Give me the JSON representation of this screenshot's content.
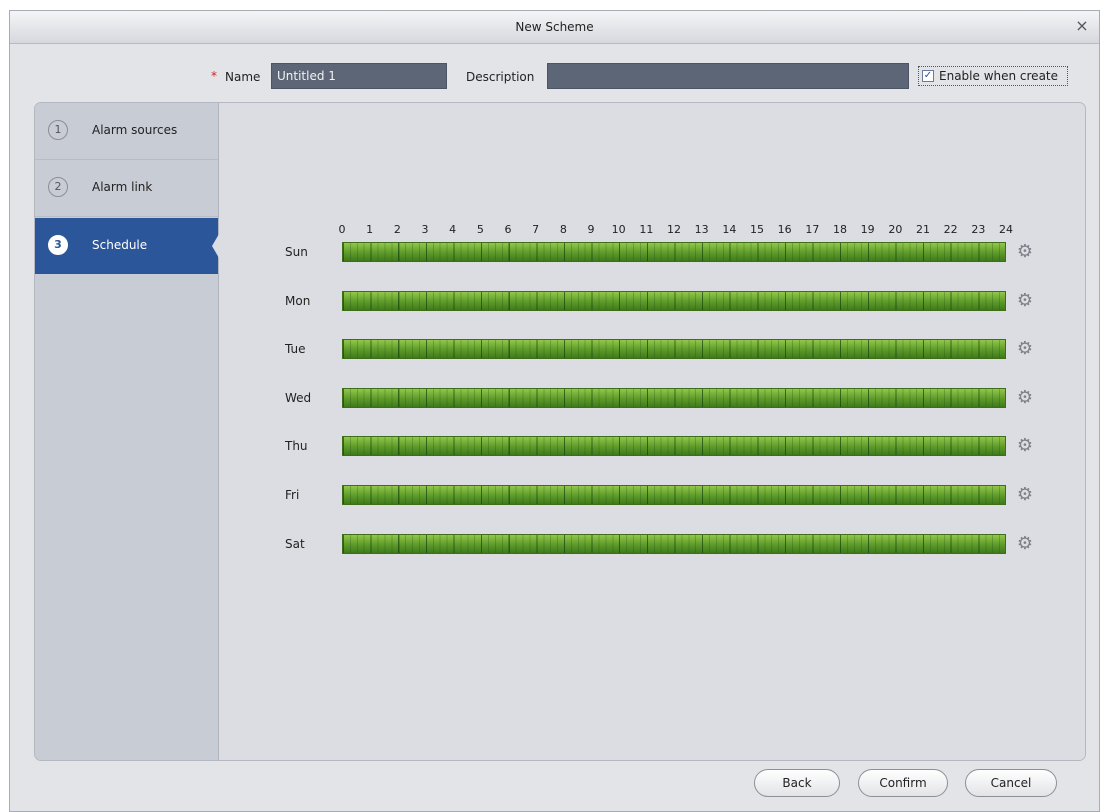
{
  "dialog": {
    "title": "New Scheme"
  },
  "form": {
    "name_label": "Name",
    "name_value": "Untitled 1",
    "required_mark": "*",
    "description_label": "Description",
    "description_value": "",
    "enable_label": "Enable when create",
    "enable_checked": true,
    "check_glyph": "✓"
  },
  "steps": [
    {
      "num": "1",
      "label": "Alarm sources"
    },
    {
      "num": "2",
      "label": "Alarm link"
    },
    {
      "num": "3",
      "label": "Schedule",
      "active": true
    }
  ],
  "schedule": {
    "hours": [
      "0",
      "1",
      "2",
      "3",
      "4",
      "5",
      "6",
      "7",
      "8",
      "9",
      "10",
      "11",
      "12",
      "13",
      "14",
      "15",
      "16",
      "17",
      "18",
      "19",
      "20",
      "21",
      "22",
      "23",
      "24"
    ],
    "days": [
      "Sun",
      "Mon",
      "Tue",
      "Wed",
      "Thu",
      "Fri",
      "Sat"
    ],
    "bar_color": "#6aa634",
    "settings_icon": "gear-icon"
  },
  "buttons": {
    "back": "Back",
    "confirm": "Confirm",
    "cancel": "Cancel"
  },
  "icons": {
    "close": "×",
    "gear": "⚙"
  }
}
